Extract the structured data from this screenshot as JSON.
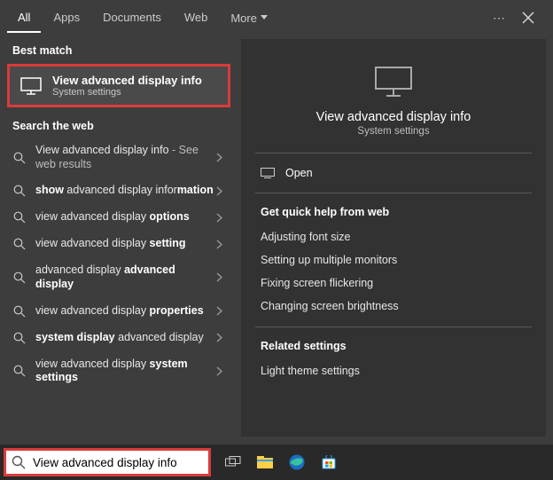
{
  "topbar": {
    "tabs": [
      "All",
      "Apps",
      "Documents",
      "Web",
      "More"
    ],
    "activeTabIndex": 0
  },
  "left": {
    "bestMatchLabel": "Best match",
    "bestMatch": {
      "title": "View advanced display info",
      "subtitle": "System settings"
    },
    "webLabel": "Search the web",
    "webItems": [
      {
        "html": "View advanced display info <span class='dim'>- See web results</span>"
      },
      {
        "html": "<strong>show</strong> advanced display infor<strong>mation</strong>"
      },
      {
        "html": "view advanced display <strong>options</strong>"
      },
      {
        "html": "view advanced display <strong>setting</strong>"
      },
      {
        "html": "advanced display <strong>advanced display</strong>"
      },
      {
        "html": "view advanced display <strong>properties</strong>"
      },
      {
        "html": "<strong>system display</strong> advanced display"
      },
      {
        "html": "view advanced display <strong>system settings</strong>"
      }
    ]
  },
  "preview": {
    "title": "View advanced display info",
    "subtitle": "System settings",
    "openLabel": "Open",
    "quickHelpHeader": "Get quick help from web",
    "quickHelpLinks": [
      "Adjusting font size",
      "Setting up multiple monitors",
      "Fixing screen flickering",
      "Changing screen brightness"
    ],
    "relatedHeader": "Related settings",
    "relatedLinks": [
      "Light theme settings"
    ]
  },
  "taskbar": {
    "searchValue": "View advanced display info"
  }
}
